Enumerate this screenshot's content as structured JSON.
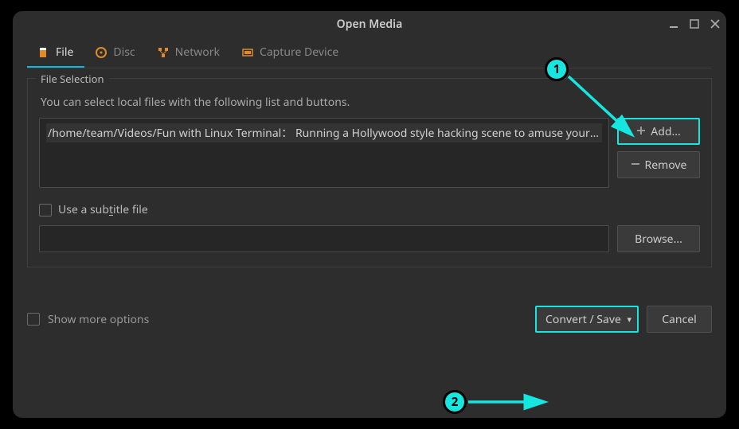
{
  "title": "Open Media",
  "tabs": [
    {
      "label": "File"
    },
    {
      "label": "Disc"
    },
    {
      "label": "Network"
    },
    {
      "label": "Capture Device"
    }
  ],
  "section": {
    "legend": "File Selection",
    "hint": "You can select local files with the following list and buttons.",
    "selected_file": "/home/team/Videos/Fun with Linux Terminal： Running a Hollywood style hacking scene to amuse your fri…",
    "add_label": "Add...",
    "remove_label": "Remove",
    "subtitle_label_pre": "Use a sub",
    "subtitle_label_hot": "t",
    "subtitle_label_post": "itle file",
    "browse_label": "Browse..."
  },
  "more_options_label": "Show more options",
  "convert_label": "Convert / Save",
  "cancel_label": "Cancel",
  "annotations": {
    "badge1": "1",
    "badge2": "2"
  }
}
